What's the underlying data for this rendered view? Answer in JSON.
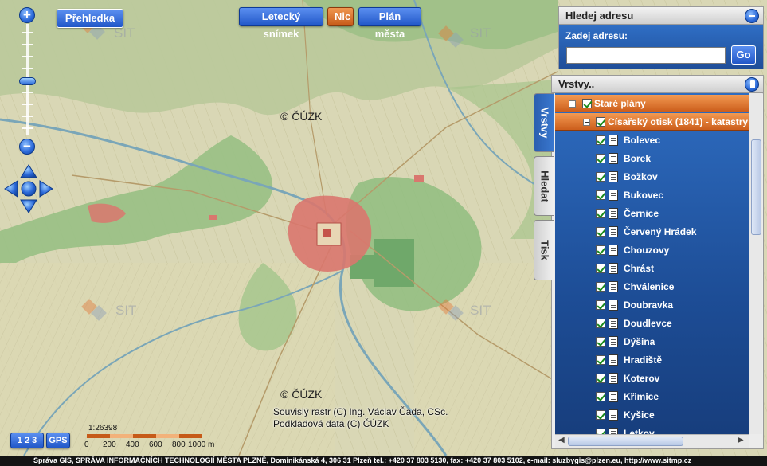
{
  "map": {
    "copyright_top": "© ČÚZK",
    "copyright_bottom": "© ČÚZK",
    "credit_line1": "Souvislý rastr (C) Ing. Václav Čada, CSc.",
    "credit_line2": "Podkladová data  (C) ČÚZK",
    "watermark": "SIT"
  },
  "toolbar": {
    "overview_label": "Přehledka",
    "aerial_label": "Letecký snímek",
    "nothing_label": "Nic",
    "city_plan_label": "Plán města"
  },
  "zoom": {
    "plus": "+",
    "minus": "−"
  },
  "address": {
    "header": "Hledej adresu",
    "prompt": "Zadej adresu:",
    "value": "",
    "go_label": "Go"
  },
  "layers": {
    "header": "Vrstvy..",
    "tabs": [
      "Vrstvy",
      "Hledat",
      "Tisk"
    ],
    "group": "Staré plány",
    "subgroup": "Císařský otisk (1841) - katastry",
    "items": [
      "Bolevec",
      "Borek",
      "Božkov",
      "Bukovec",
      "Černice",
      "Červený Hrádek",
      "Chouzovy",
      "Chrást",
      "Chválenice",
      "Doubravka",
      "Doudlevce",
      "Dýšina",
      "Hradiště",
      "Koterov",
      "Křimice",
      "Kyšice",
      "Letkov"
    ]
  },
  "bottom_tools": {
    "numbers_label": "1 2 3",
    "gps_label": "GPS"
  },
  "scale": {
    "ratio": "1:26398",
    "labels": [
      "0",
      "200",
      "400",
      "600",
      "800",
      "1000 m"
    ]
  },
  "footer": {
    "text": "Správa GIS, SPRÁVA INFORMAČNÍCH TECHNOLOGIÍ MĚSTA PLZNĚ, Dominikánská 4, 306 31 Plzeň tel.: +420 37 803 5130, fax: +420 37 803 5102, e-mail:    sluzbygis@plzen.eu,    http://www.sitmp.cz"
  },
  "colors": {
    "accent_blue": "#2157c8",
    "accent_orange": "#c65a18",
    "map_base": "#d7d6b4",
    "map_forest": "#8cb57a",
    "map_town": "#d9776e"
  }
}
